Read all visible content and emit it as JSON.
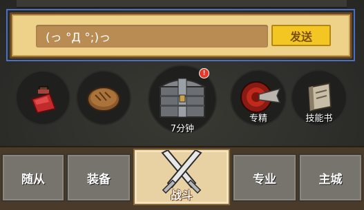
{
  "chat": {
    "input_value": "(っ °Д °;)っ",
    "send_label": "发送"
  },
  "items": [
    {
      "name": "potion",
      "label": ""
    },
    {
      "name": "bread",
      "label": ""
    },
    {
      "name": "treasure-chest",
      "label": "7分钟",
      "has_alert": true
    },
    {
      "name": "specialize",
      "label": "专精"
    },
    {
      "name": "skill-book",
      "label": "技能书"
    }
  ],
  "nav": {
    "tabs": [
      "随从",
      "装备",
      "战斗",
      "专业",
      "主城"
    ],
    "active": "战斗"
  },
  "colors": {
    "panel": "#eed28a",
    "send_button": "#f3c623",
    "tab": "#77746d",
    "active_tab": "#e8d2a4",
    "badge": "#e2392a"
  }
}
